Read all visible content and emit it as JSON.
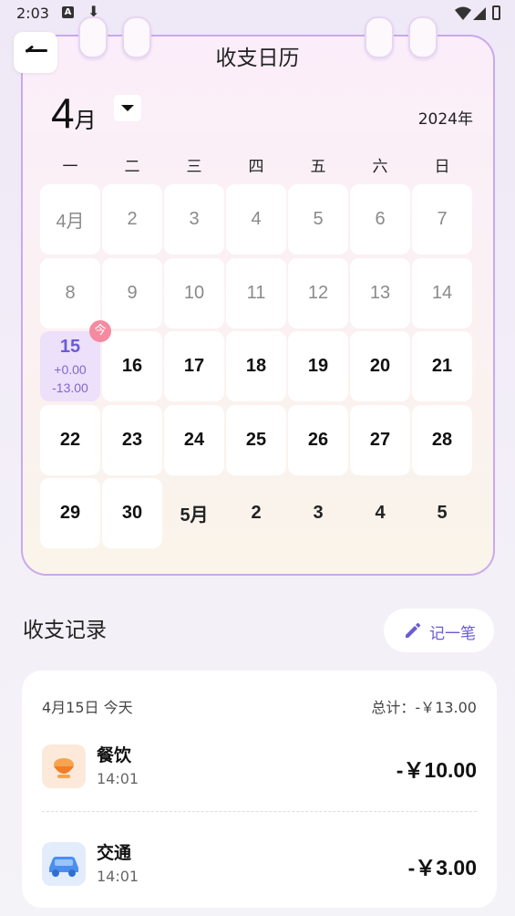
{
  "status_bar": {
    "time": "2:03",
    "a_icon": "A",
    "download_icon": "⬇"
  },
  "header": {
    "title": "收支日历"
  },
  "calendar": {
    "month_number": "4",
    "month_unit": "月",
    "year": "2024年",
    "weekdays": [
      "一",
      "二",
      "三",
      "四",
      "五",
      "六",
      "日"
    ],
    "days": [
      {
        "label": "4月",
        "state": "muted"
      },
      {
        "label": "2",
        "state": "muted"
      },
      {
        "label": "3",
        "state": "muted"
      },
      {
        "label": "4",
        "state": "muted"
      },
      {
        "label": "5",
        "state": "muted"
      },
      {
        "label": "6",
        "state": "muted"
      },
      {
        "label": "7",
        "state": "muted"
      },
      {
        "label": "8",
        "state": "muted"
      },
      {
        "label": "9",
        "state": "muted"
      },
      {
        "label": "10",
        "state": "muted"
      },
      {
        "label": "11",
        "state": "muted"
      },
      {
        "label": "12",
        "state": "muted"
      },
      {
        "label": "13",
        "state": "muted"
      },
      {
        "label": "14",
        "state": "muted"
      },
      {
        "label": "15",
        "state": "today",
        "income": "+0.00",
        "expense": "-13.00"
      },
      {
        "label": "16",
        "state": "active"
      },
      {
        "label": "17",
        "state": "active"
      },
      {
        "label": "18",
        "state": "active"
      },
      {
        "label": "19",
        "state": "active"
      },
      {
        "label": "20",
        "state": "active"
      },
      {
        "label": "21",
        "state": "active"
      },
      {
        "label": "22",
        "state": "active"
      },
      {
        "label": "23",
        "state": "active"
      },
      {
        "label": "24",
        "state": "active"
      },
      {
        "label": "25",
        "state": "active"
      },
      {
        "label": "26",
        "state": "active"
      },
      {
        "label": "27",
        "state": "active"
      },
      {
        "label": "28",
        "state": "active"
      },
      {
        "label": "29",
        "state": "active"
      },
      {
        "label": "30",
        "state": "active"
      },
      {
        "label": "5月",
        "state": "next"
      },
      {
        "label": "2",
        "state": "next"
      },
      {
        "label": "3",
        "state": "next"
      },
      {
        "label": "4",
        "state": "next"
      },
      {
        "label": "5",
        "state": "next"
      }
    ],
    "today_badge": "今"
  },
  "records": {
    "title": "收支记录",
    "add_button": "记一笔",
    "date_label": "4月15日 今天",
    "total_label": "总计：-￥13.00",
    "items": [
      {
        "name": "餐饮",
        "time": "14:01",
        "amount": "-￥10.00",
        "icon": "food-icon"
      },
      {
        "name": "交通",
        "time": "14:01",
        "amount": "-￥3.00",
        "icon": "car-icon"
      }
    ]
  },
  "colors": {
    "accent": "#6b5bd6",
    "card_border": "#c9a9ec",
    "today_bg": "#ece0fa",
    "badge": "#f58aa0"
  }
}
